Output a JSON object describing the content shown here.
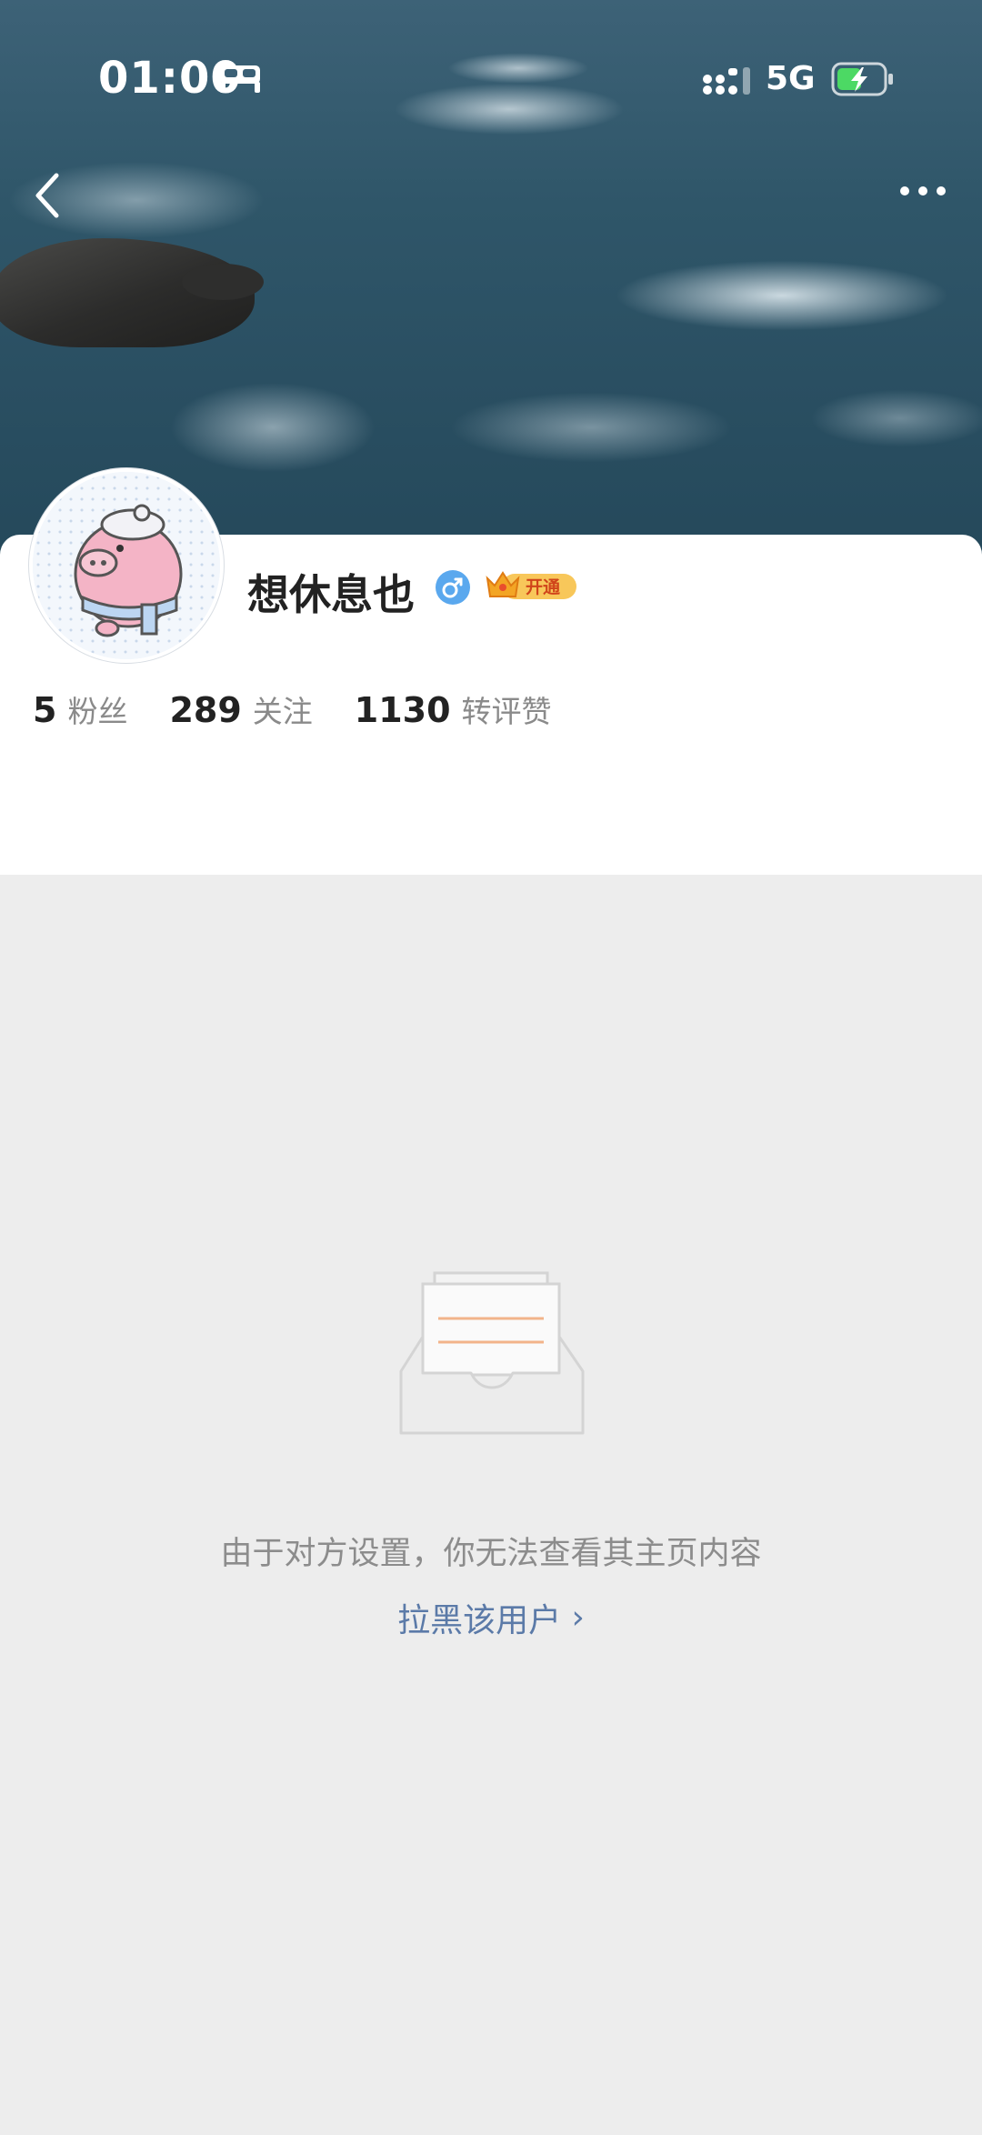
{
  "status_bar": {
    "time": "01:00",
    "network": "5G"
  },
  "profile": {
    "name": "想休息也",
    "vip_label": "开通",
    "stats": [
      {
        "value": "5",
        "label": "粉丝"
      },
      {
        "value": "289",
        "label": "关注"
      },
      {
        "value": "1130",
        "label": "转评赞"
      }
    ]
  },
  "empty_state": {
    "message": "由于对方设置，你无法查看其主页内容",
    "block_label": "拉黑该用户",
    "block_chevron": "›"
  },
  "icons": {
    "back": "back-arrow-icon",
    "more": "more-dots-icon",
    "sleep": "bed-icon",
    "signal": "signal-icon",
    "battery": "battery-charging-icon",
    "gender": "male-icon",
    "vip": "crown-icon",
    "empty": "empty-inbox-icon"
  },
  "colors": {
    "link": "#5b7aa8",
    "gender": "#5aa8ee",
    "vip": "#f5a623",
    "background": "#ededed"
  }
}
